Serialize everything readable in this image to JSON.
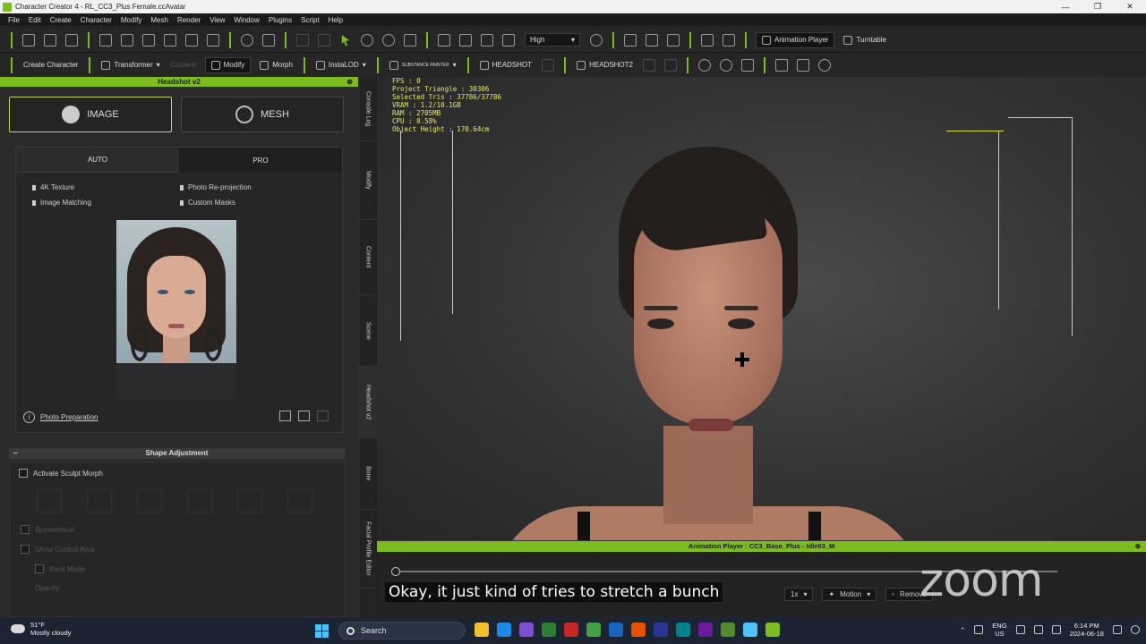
{
  "window": {
    "title": "Character Creator 4 - RL_CC3_Plus Female.ccAvatar"
  },
  "menu": [
    "File",
    "Edit",
    "Create",
    "Character",
    "Modify",
    "Mesh",
    "Render",
    "View",
    "Window",
    "Plugins",
    "Script",
    "Help"
  ],
  "toolbar1": {
    "quality_select": "High",
    "animation_player": "Animation Player",
    "turntable": "Turntable"
  },
  "toolbar2": {
    "create_character": "Create Character",
    "transformer": "Transformer",
    "content": "Content",
    "modify": "Modify",
    "morph": "Morph",
    "instalod": "InstaLOD",
    "substance": "SUBSTANCE PAINTER",
    "headshot": "HEADSHOT",
    "headshot2": "HEADSHOT2"
  },
  "left_panel": {
    "header": "Headshot v2",
    "image_button": "IMAGE",
    "mesh_button": "MESH",
    "tabs": [
      "AUTO",
      "PRO"
    ],
    "features": [
      "4K Texture",
      "Photo Re-projection",
      "Image Matching",
      "Custom Masks"
    ],
    "photo_prep": "Photo Preparation",
    "shape_adjustment": "Shape Adjustment",
    "activate_sculpt": "Activate Sculpt Morph",
    "dim_options": [
      "Symmetrical",
      "Show Control Area",
      "Back Mode",
      "Opacity"
    ]
  },
  "side_tabs": [
    "Console Log",
    "Modify",
    "Content",
    "Scene",
    "Headshot v2",
    "Bone",
    "Facial Profile Editor"
  ],
  "viewport": {
    "stats": [
      "FPS : 0",
      "Project Triangle : 30306",
      "Selected Tris : 37786/37786",
      "VRAM : 1.2/10.1GB",
      "RAM : 2705MB",
      "CPU : 0.58%",
      "Object Height : 170.64cm"
    ]
  },
  "animation_player": {
    "header": "Animation Player : CC3_Base_Plus - Idle03_M",
    "speed": "1x",
    "motion": "Motion",
    "remove": "Remove"
  },
  "zoom_logo": "zoom",
  "caption": "Okay, it just kind of tries to stretch a bunch",
  "taskbar": {
    "temp": "51°F",
    "weather": "Mostly cloudy",
    "search": "Search",
    "lang": "ENG",
    "region": "US",
    "time": "6:14 PM",
    "date": "2024-06-18",
    "app_colors": [
      "#f0c030",
      "#1e88e5",
      "#7b4fcf",
      "#2e7d32",
      "#c62828",
      "#43a047",
      "#1565c0",
      "#e65100",
      "#283593",
      "#00838f",
      "#6a1b9a",
      "#558b2f",
      "#4fc3f7",
      "#7cbc1e"
    ]
  }
}
